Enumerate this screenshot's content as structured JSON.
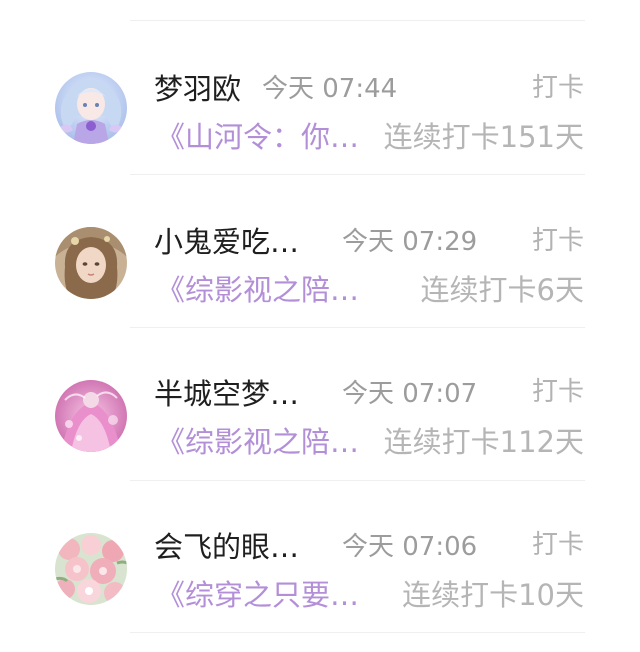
{
  "feed": {
    "items": [
      {
        "name": "梦羽欧",
        "time": "今天 07:44",
        "tag": "打卡",
        "book": "《山河令：你…",
        "streak": "连续打卡151天",
        "avatar_icon": "anime-girl-blue-avatar"
      },
      {
        "name": "小鬼爱吃…",
        "time": "今天 07:29",
        "tag": "打卡",
        "book": "《综影视之陪…",
        "streak": "连续打卡6天",
        "avatar_icon": "painted-girl-portrait-avatar"
      },
      {
        "name": "半城空梦…",
        "time": "今天 07:07",
        "tag": "打卡",
        "book": "《综影视之陪…",
        "streak": "连续打卡112天",
        "avatar_icon": "pink-dress-avatar"
      },
      {
        "name": "会飞的眼…",
        "time": "今天 07:06",
        "tag": "打卡",
        "book": "《综穿之只要…",
        "streak": "连续打卡10天",
        "avatar_icon": "pink-flowers-avatar"
      }
    ]
  },
  "colors": {
    "name": "#1f1f1f",
    "time": "#9c9c9c",
    "book": "#b38fd8",
    "streak": "#b5b5b5",
    "divider": "#efefef"
  }
}
